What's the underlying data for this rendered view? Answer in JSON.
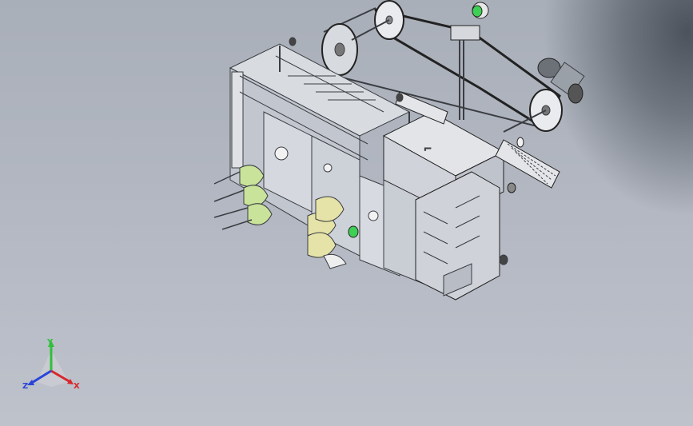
{
  "viewport": {
    "background_top": "#a9afb9",
    "background_bottom": "#bec2cb",
    "shadow_color": "#4c535c"
  },
  "model": {
    "line_color": "#3a3d42",
    "panel_color": "#c9ccd3",
    "highlight_yellow": "#e6e3a8",
    "highlight_green": "#c9e39a",
    "status_green": "#3ecf55"
  },
  "triad": {
    "axis_y_label": "Y",
    "axis_x_label": "X",
    "axis_z_label": "Z",
    "axis_y_color": "#2fbf3a",
    "axis_x_color": "#d8262a",
    "axis_z_color": "#2a45d8"
  }
}
